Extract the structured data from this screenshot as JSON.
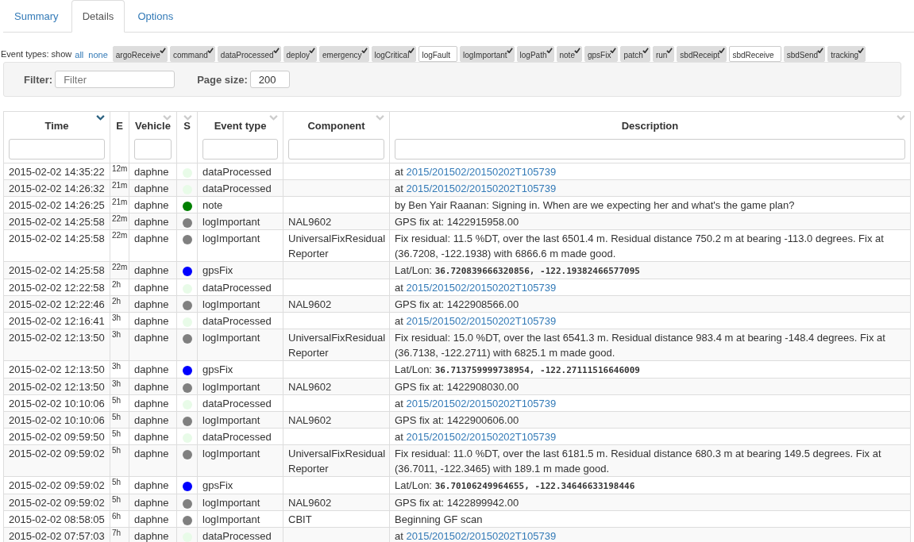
{
  "tabs": [
    {
      "label": "Summary",
      "selected": false
    },
    {
      "label": "Details",
      "selected": true
    },
    {
      "label": "Options",
      "selected": false
    }
  ],
  "event_types": {
    "label": "Event types: show",
    "all": "all",
    "none": "none",
    "items": [
      {
        "label": "argoReceive",
        "checked": true
      },
      {
        "label": "command",
        "checked": true
      },
      {
        "label": "dataProcessed",
        "checked": true
      },
      {
        "label": "deploy",
        "checked": true
      },
      {
        "label": "emergency",
        "checked": true
      },
      {
        "label": "logCritical",
        "checked": true
      },
      {
        "label": "logFault",
        "checked": false
      },
      {
        "label": "logImportant",
        "checked": true
      },
      {
        "label": "logPath",
        "checked": true
      },
      {
        "label": "note",
        "checked": true
      },
      {
        "label": "gpsFix",
        "checked": true
      },
      {
        "label": "patch",
        "checked": true
      },
      {
        "label": "run",
        "checked": true
      },
      {
        "label": "sbdReceipt",
        "checked": true
      },
      {
        "label": "sbdReceive",
        "checked": false
      },
      {
        "label": "sbdSend",
        "checked": true
      },
      {
        "label": "tracking",
        "checked": true
      }
    ]
  },
  "filter": {
    "label": "Filter:",
    "placeholder": "Filter"
  },
  "page_size": {
    "label": "Page size:",
    "value": "200"
  },
  "table": {
    "columns": [
      {
        "label": "Time",
        "filter": true,
        "sortable": true,
        "sorted": true
      },
      {
        "label": "E",
        "filter": false,
        "sortable": false,
        "sorted": false
      },
      {
        "label": "Vehicle",
        "filter": true,
        "sortable": true,
        "sorted": false
      },
      {
        "label": "S",
        "filter": false,
        "sortable": true,
        "sorted": false
      },
      {
        "label": "Event type",
        "filter": true,
        "sortable": true,
        "sorted": false
      },
      {
        "label": "Component",
        "filter": true,
        "sortable": true,
        "sorted": false
      },
      {
        "label": "Description",
        "filter": true,
        "sortable": true,
        "sorted": false
      }
    ],
    "rows": [
      {
        "time": "2015-02-02 14:35:22",
        "elapsed": "12m",
        "vehicle": "daphne",
        "color": "#e8fbe8",
        "event_type": "dataProcessed",
        "component": "",
        "description": {
          "kind": "link",
          "prefix": "at",
          "link": "2015/201502/20150202T105739"
        }
      },
      {
        "time": "2015-02-02 14:26:32",
        "elapsed": "21m",
        "vehicle": "daphne",
        "color": "#e8fbe8",
        "event_type": "dataProcessed",
        "component": "",
        "description": {
          "kind": "link",
          "prefix": "at",
          "link": "2015/201502/20150202T105739"
        }
      },
      {
        "time": "2015-02-02 14:26:25",
        "elapsed": "21m",
        "vehicle": "daphne",
        "color": "#008000",
        "event_type": "note",
        "component": "",
        "description": {
          "kind": "text",
          "text": "by Ben Yair Raanan: Signing in. When are we expecting her and what's the game plan?"
        }
      },
      {
        "time": "2015-02-02 14:25:58",
        "elapsed": "22m",
        "vehicle": "daphne",
        "color": "#808080",
        "event_type": "logImportant",
        "component": "NAL9602",
        "description": {
          "kind": "text",
          "text": "GPS fix at: 1422915958.00"
        }
      },
      {
        "time": "2015-02-02 14:25:58",
        "elapsed": "22m",
        "vehicle": "daphne",
        "color": "#808080",
        "event_type": "logImportant",
        "component": "UniversalFixResidual Reporter",
        "description": {
          "kind": "text",
          "text": "Fix residual: 11.5 %DT, over the last 6501.4 m. Residual distance 750.2 m at bearing -113.0 degrees. Fix at (36.7208, -122.1938) with 6866.6 m made good."
        }
      },
      {
        "time": "2015-02-02 14:25:58",
        "elapsed": "22m",
        "vehicle": "daphne",
        "color": "#0000ff",
        "event_type": "gpsFix",
        "component": "",
        "description": {
          "kind": "position",
          "prefix": "Lat/Lon:",
          "value": "36.720839666320856, -122.19382466577095"
        }
      },
      {
        "time": "2015-02-02 12:22:58",
        "elapsed": "2h",
        "vehicle": "daphne",
        "color": "#e8fbe8",
        "event_type": "dataProcessed",
        "component": "",
        "description": {
          "kind": "link",
          "prefix": "at",
          "link": "2015/201502/20150202T105739"
        }
      },
      {
        "time": "2015-02-02 12:22:46",
        "elapsed": "2h",
        "vehicle": "daphne",
        "color": "#808080",
        "event_type": "logImportant",
        "component": "NAL9602",
        "description": {
          "kind": "text",
          "text": "GPS fix at: 1422908566.00"
        }
      },
      {
        "time": "2015-02-02 12:16:41",
        "elapsed": "3h",
        "vehicle": "daphne",
        "color": "#e8fbe8",
        "event_type": "dataProcessed",
        "component": "",
        "description": {
          "kind": "link",
          "prefix": "at",
          "link": "2015/201502/20150202T105739"
        }
      },
      {
        "time": "2015-02-02 12:13:50",
        "elapsed": "3h",
        "vehicle": "daphne",
        "color": "#808080",
        "event_type": "logImportant",
        "component": "UniversalFixResidual Reporter",
        "description": {
          "kind": "text",
          "text": "Fix residual: 15.0 %DT, over the last 6541.3 m. Residual distance 983.4 m at bearing -148.4 degrees. Fix at (36.7138, -122.2711) with 6825.1 m made good."
        }
      },
      {
        "time": "2015-02-02 12:13:50",
        "elapsed": "3h",
        "vehicle": "daphne",
        "color": "#0000ff",
        "event_type": "gpsFix",
        "component": "",
        "description": {
          "kind": "position",
          "prefix": "Lat/Lon:",
          "value": "36.713759999738954, -122.27111516646009"
        }
      },
      {
        "time": "2015-02-02 12:13:50",
        "elapsed": "3h",
        "vehicle": "daphne",
        "color": "#808080",
        "event_type": "logImportant",
        "component": "NAL9602",
        "description": {
          "kind": "text",
          "text": "GPS fix at: 1422908030.00"
        }
      },
      {
        "time": "2015-02-02 10:10:06",
        "elapsed": "5h",
        "vehicle": "daphne",
        "color": "#e8fbe8",
        "event_type": "dataProcessed",
        "component": "",
        "description": {
          "kind": "link",
          "prefix": "at",
          "link": "2015/201502/20150202T105739"
        }
      },
      {
        "time": "2015-02-02 10:10:06",
        "elapsed": "5h",
        "vehicle": "daphne",
        "color": "#808080",
        "event_type": "logImportant",
        "component": "NAL9602",
        "description": {
          "kind": "text",
          "text": "GPS fix at: 1422900606.00"
        }
      },
      {
        "time": "2015-02-02 09:59:50",
        "elapsed": "5h",
        "vehicle": "daphne",
        "color": "#e8fbe8",
        "event_type": "dataProcessed",
        "component": "",
        "description": {
          "kind": "link",
          "prefix": "at",
          "link": "2015/201502/20150202T105739"
        }
      },
      {
        "time": "2015-02-02 09:59:02",
        "elapsed": "5h",
        "vehicle": "daphne",
        "color": "#808080",
        "event_type": "logImportant",
        "component": "UniversalFixResidual Reporter",
        "description": {
          "kind": "text",
          "text": "Fix residual: 11.0 %DT, over the last 6181.5 m. Residual distance 680.3 m at bearing 149.5 degrees. Fix at (36.7011, -122.3465) with 189.1 m made good."
        }
      },
      {
        "time": "2015-02-02 09:59:02",
        "elapsed": "5h",
        "vehicle": "daphne",
        "color": "#0000ff",
        "event_type": "gpsFix",
        "component": "",
        "description": {
          "kind": "position",
          "prefix": "Lat/Lon:",
          "value": "36.70106249964655, -122.34646633198446"
        }
      },
      {
        "time": "2015-02-02 09:59:02",
        "elapsed": "5h",
        "vehicle": "daphne",
        "color": "#808080",
        "event_type": "logImportant",
        "component": "NAL9602",
        "description": {
          "kind": "text",
          "text": "GPS fix at: 1422899942.00"
        }
      },
      {
        "time": "2015-02-02 08:58:05",
        "elapsed": "6h",
        "vehicle": "daphne",
        "color": "#808080",
        "event_type": "logImportant",
        "component": "CBIT",
        "description": {
          "kind": "text",
          "text": "Beginning GF scan"
        }
      },
      {
        "time": "2015-02-02 07:57:03",
        "elapsed": "7h",
        "vehicle": "daphne",
        "color": "#e8fbe8",
        "event_type": "dataProcessed",
        "component": "",
        "description": {
          "kind": "link",
          "prefix": "at",
          "link": "2015/201502/20150202T105739"
        }
      }
    ]
  }
}
